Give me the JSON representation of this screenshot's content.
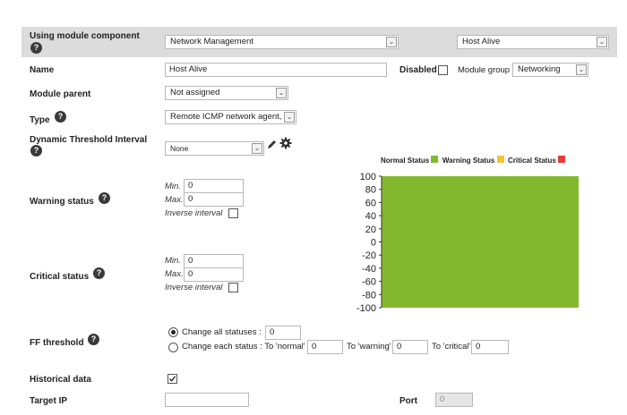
{
  "module_component": {
    "label": "Using module component",
    "component_value": "Network Management",
    "template_value": "Host Alive"
  },
  "name": {
    "label": "Name",
    "value": "Host Alive",
    "disabled_label": "Disabled",
    "module_group_label": "Module group",
    "module_group_value": "Networking"
  },
  "parent": {
    "label": "Module parent",
    "value": "Not assigned"
  },
  "type": {
    "label": "Type",
    "value": "Remote ICMP network agent,"
  },
  "threshold_interval": {
    "label": "Dynamic Threshold Interval",
    "value": "None"
  },
  "warning": {
    "label": "Warning status",
    "min_label": "Min.",
    "min_value": "0",
    "max_label": "Max.",
    "max_value": "0",
    "inverse_label": "Inverse interval"
  },
  "critical": {
    "label": "Critical status",
    "min_label": "Min.",
    "min_value": "0",
    "max_label": "Max.",
    "max_value": "0",
    "inverse_label": "Inverse interval"
  },
  "ff": {
    "label": "FF threshold",
    "all_label": "Change all statuses :",
    "all_value": "0",
    "each_label": "Change each status : To 'normal'",
    "normal_value": "0",
    "warning_label": "To 'warning'",
    "warning_value": "0",
    "critical_label": "To 'critical'",
    "critical_value": "0"
  },
  "historical": {
    "label": "Historical data"
  },
  "target": {
    "label": "Target IP",
    "value": "",
    "port_label": "Port",
    "port_value": "0"
  },
  "icons": {
    "help": "?",
    "edit": "pencil-icon",
    "settings": "gear-icon"
  },
  "chart_data": {
    "type": "area",
    "series": [
      {
        "name": "Normal Status",
        "color": "#84b82e"
      },
      {
        "name": "Warning Status",
        "color": "#f2c335"
      },
      {
        "name": "Critical Status",
        "color": "#e63c3c"
      }
    ],
    "ylim": [
      -100,
      100
    ],
    "yticks": [
      "100",
      "80",
      "60",
      "40",
      "20",
      "0",
      "-20",
      "-40",
      "-60",
      "-80",
      "-100"
    ],
    "normal_range": [
      -100,
      100
    ],
    "legend": "top"
  }
}
